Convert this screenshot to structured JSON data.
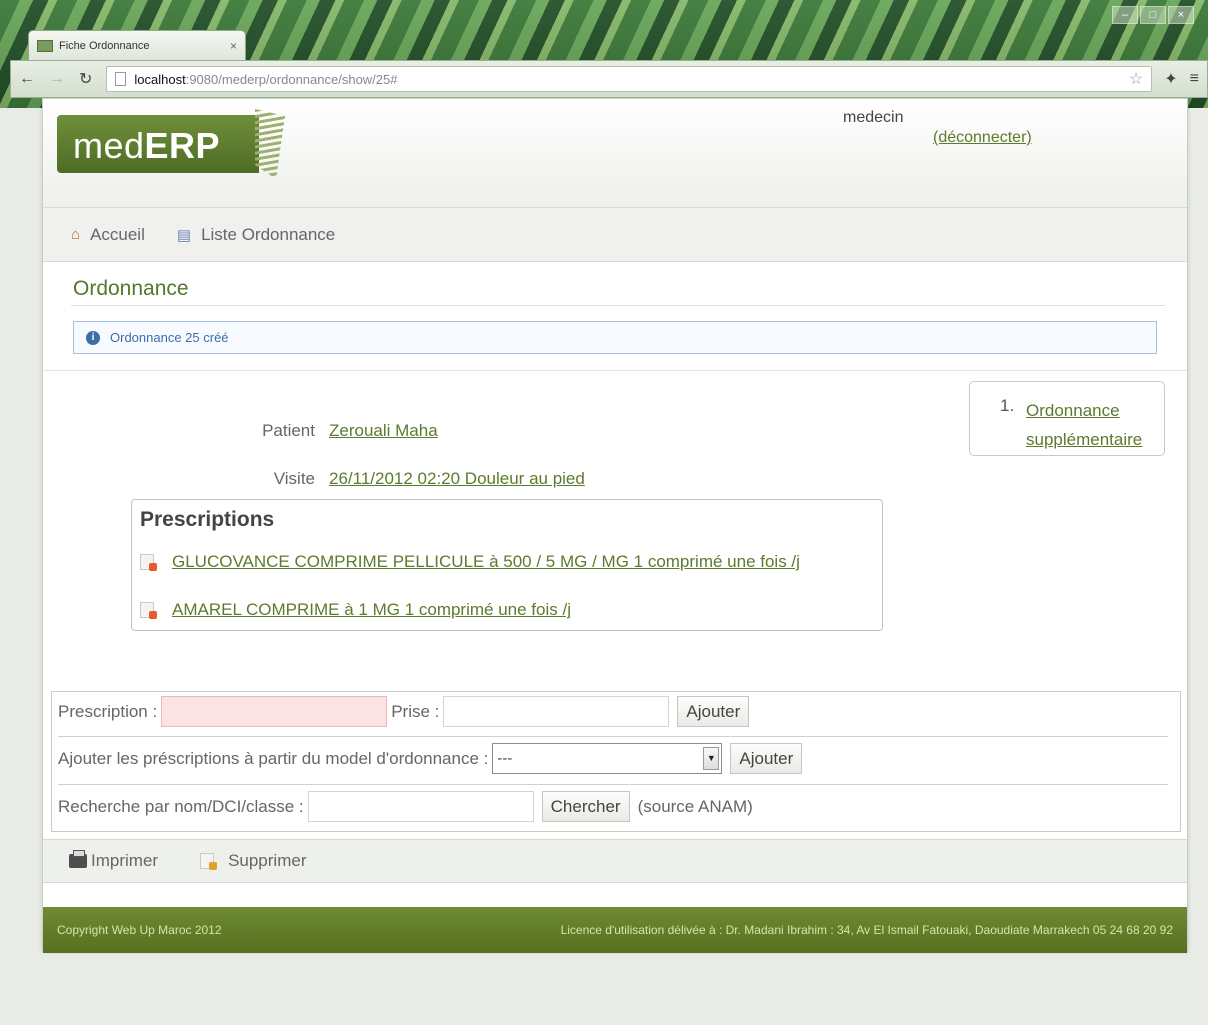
{
  "browser": {
    "tab_title": "Fiche Ordonnance",
    "tab_close": "×",
    "url_host": "localhost",
    "url_path": ":9080/mederp/ordonnance/show/25#",
    "window_controls": [
      "–",
      "□",
      "×"
    ]
  },
  "header": {
    "logo_light": "med",
    "logo_bold": "ERP",
    "user": "medecin",
    "logout": "(déconnecter)"
  },
  "nav": {
    "home": "Accueil",
    "list": "Liste Ordonnance"
  },
  "main": {
    "title": "Ordonnance",
    "message": "Ordonnance 25 créé",
    "side": {
      "number": "1.",
      "link_line1": "Ordonnance",
      "link_line2": "supplémentaire"
    },
    "patient_label": "Patient",
    "patient_value": "Zerouali Maha",
    "visit_label": "Visite",
    "visit_value": "26/11/2012 02:20 Douleur au pied",
    "prescriptions_title": "Prescriptions",
    "prescriptions": [
      "GLUCOVANCE COMPRIME PELLICULE à 500 / 5 MG / MG 1 comprimé une fois /j",
      "AMAREL COMPRIME à 1 MG 1 comprimé une fois /j"
    ]
  },
  "form": {
    "prescription_label": "Prescription :",
    "prise_label": "Prise :",
    "add_label": "Ajouter",
    "model_label": "Ajouter les préscriptions à partir du model d'ordonnance :",
    "model_selected": "---",
    "model_add_label": "Ajouter",
    "search_label": "Recherche par nom/DCI/classe :",
    "search_button": "Chercher",
    "source": "(source ANAM)"
  },
  "actions": {
    "print": "Imprimer",
    "delete": "Supprimer"
  },
  "footer": {
    "copyright": "Copyright Web Up Maroc 2012",
    "license": "Licence d'utilisation délivée à : Dr. Madani Ibrahim : 34, Av El Ismail Fatouaki, Daoudiate Marrakech 05 24 68 20 92"
  }
}
